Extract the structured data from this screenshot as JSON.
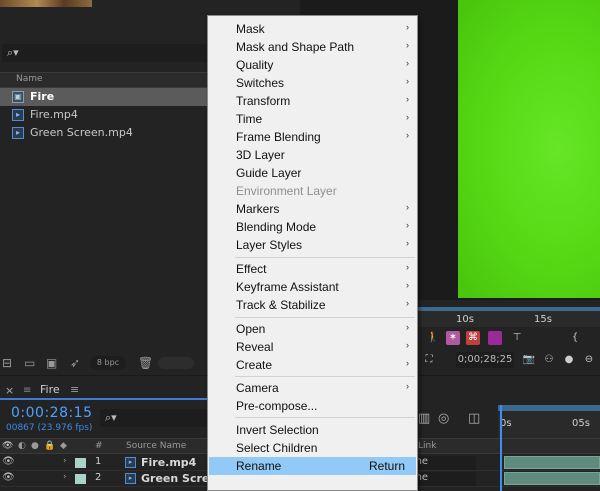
{
  "project": {
    "search_icon": "search-icon",
    "column_name": "Name",
    "items": [
      {
        "label": "Fire",
        "selected": true,
        "icon": "composition-icon"
      },
      {
        "label": "Fire.mp4",
        "selected": false,
        "icon": "footage-icon"
      },
      {
        "label": "Green Screen.mp4",
        "selected": false,
        "icon": "footage-icon"
      }
    ],
    "bit_depth": "8 bpc"
  },
  "viewer": {
    "ruler_labels": [
      "10s",
      "15s"
    ],
    "timecode": "0;00;28;25",
    "background_color": "#55d814"
  },
  "timeline": {
    "tab_label": "Fire",
    "current_time": "0:00:28:15",
    "frames_fps": "00867 (23.976 fps)",
    "columns": {
      "hash": "#",
      "source_name": "Source Name",
      "link": "Link"
    },
    "ruler_labels": [
      "0s",
      "05s"
    ],
    "layers": [
      {
        "num": "1",
        "name": "Fire.mp4",
        "mode": "None"
      },
      {
        "num": "2",
        "name": "Green Screen.mp4",
        "mode": "None"
      }
    ]
  },
  "context_menu": {
    "items": [
      {
        "label": "Mask",
        "submenu": true
      },
      {
        "label": "Mask and Shape Path",
        "submenu": true
      },
      {
        "label": "Quality",
        "submenu": true
      },
      {
        "label": "Switches",
        "submenu": true
      },
      {
        "label": "Transform",
        "submenu": true
      },
      {
        "label": "Time",
        "submenu": true
      },
      {
        "label": "Frame Blending",
        "submenu": true
      },
      {
        "label": "3D Layer",
        "submenu": false
      },
      {
        "label": "Guide Layer",
        "submenu": false
      },
      {
        "label": "Environment Layer",
        "submenu": false,
        "disabled": true
      },
      {
        "label": "Markers",
        "submenu": true
      },
      {
        "label": "Blending Mode",
        "submenu": true
      },
      {
        "label": "Layer Styles",
        "submenu": true
      },
      {
        "label": "Effect",
        "submenu": true
      },
      {
        "label": "Keyframe Assistant",
        "submenu": true
      },
      {
        "label": "Track & Stabilize",
        "submenu": true
      },
      {
        "label": "Open",
        "submenu": true
      },
      {
        "label": "Reveal",
        "submenu": true
      },
      {
        "label": "Create",
        "submenu": true
      },
      {
        "label": "Camera",
        "submenu": true
      },
      {
        "label": "Pre-compose...",
        "submenu": false
      },
      {
        "label": "Invert Selection",
        "submenu": false
      },
      {
        "label": "Select Children",
        "submenu": false
      },
      {
        "label": "Rename",
        "submenu": false,
        "shortcut": "Return",
        "highlighted": true
      }
    ]
  }
}
